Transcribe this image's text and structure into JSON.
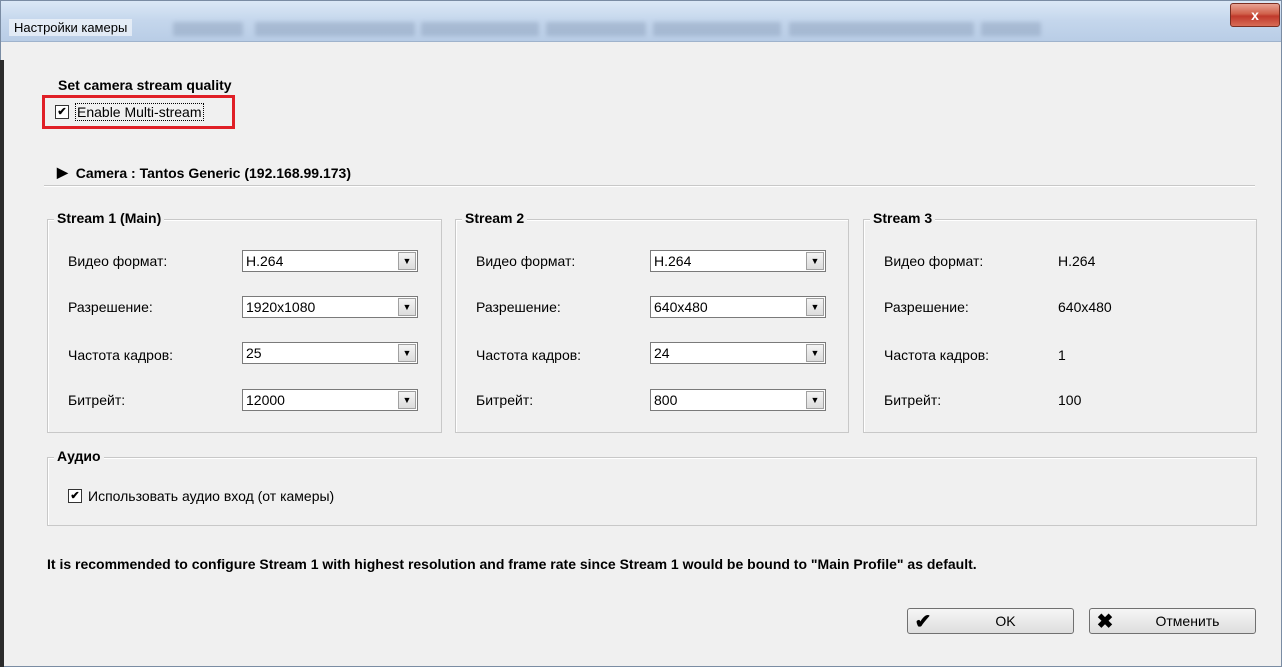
{
  "window": {
    "title": "Настройки камеры",
    "close_label": "x"
  },
  "quality": {
    "heading": "Set camera stream quality",
    "multistream_label": "Enable Multi-stream",
    "multistream_checked": true
  },
  "camera": {
    "label": "Camera : Tantos Generic (192.168.99.173)"
  },
  "field_labels": {
    "video_format": "Видео формат:",
    "resolution": "Разрешение:",
    "frame_rate": "Частота кадров:",
    "bitrate": "Битрейт:"
  },
  "streams": [
    {
      "title": "Stream 1 (Main)",
      "video_format": "H.264",
      "resolution": "1920x1080",
      "frame_rate": "25",
      "bitrate": "12000"
    },
    {
      "title": "Stream 2",
      "video_format": "H.264",
      "resolution": "640x480",
      "frame_rate": "24",
      "bitrate": "800"
    },
    {
      "title": "Stream 3",
      "video_format": "H.264",
      "resolution": "640x480",
      "frame_rate": "1",
      "bitrate": "100"
    }
  ],
  "audio": {
    "title": "Аудио",
    "use_audio_label": "Использовать аудио вход (от камеры)",
    "use_audio_checked": true
  },
  "note": "It is recommended to configure Stream 1 with highest resolution and frame rate since Stream 1 would be bound to \"Main Profile\" as default.",
  "buttons": {
    "ok_label": "OK",
    "cancel_label": "Отменить"
  },
  "icons": {
    "checkmark": "checkmark-icon",
    "cross": "cross-icon",
    "expand": "triangle-right-icon",
    "dropdown": "chevron-down-icon"
  },
  "colors": {
    "highlight": "#e01f26",
    "close_button": "#c0392b"
  }
}
